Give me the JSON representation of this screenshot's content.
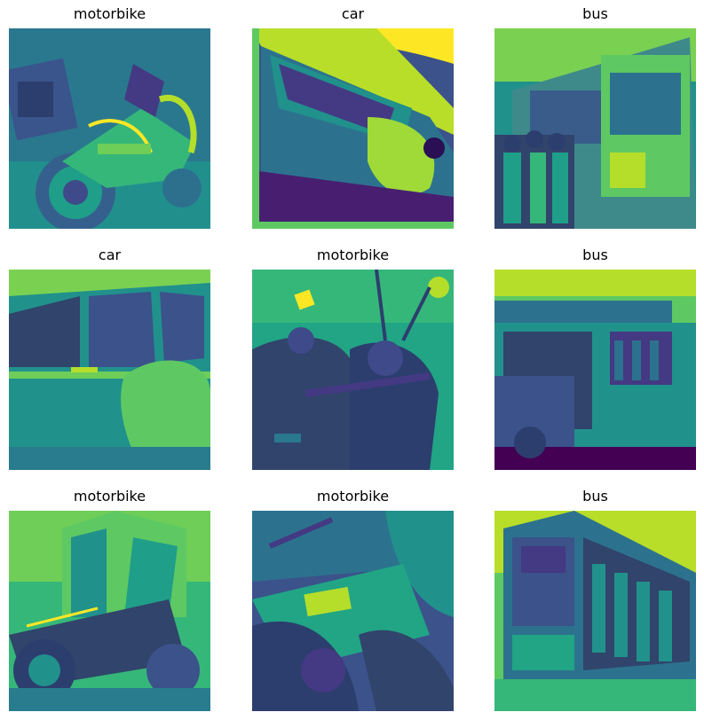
{
  "grid": {
    "cells": [
      {
        "label": "motorbike"
      },
      {
        "label": "car"
      },
      {
        "label": "bus"
      },
      {
        "label": "car"
      },
      {
        "label": "motorbike"
      },
      {
        "label": "bus"
      },
      {
        "label": "motorbike"
      },
      {
        "label": "motorbike"
      },
      {
        "label": "bus"
      }
    ]
  },
  "colors": {
    "dark": "#3b0f70",
    "deep": "#31446b",
    "mid": "#277f8e",
    "teal": "#21a585",
    "green": "#5ec962",
    "yellow": "#fde725"
  }
}
